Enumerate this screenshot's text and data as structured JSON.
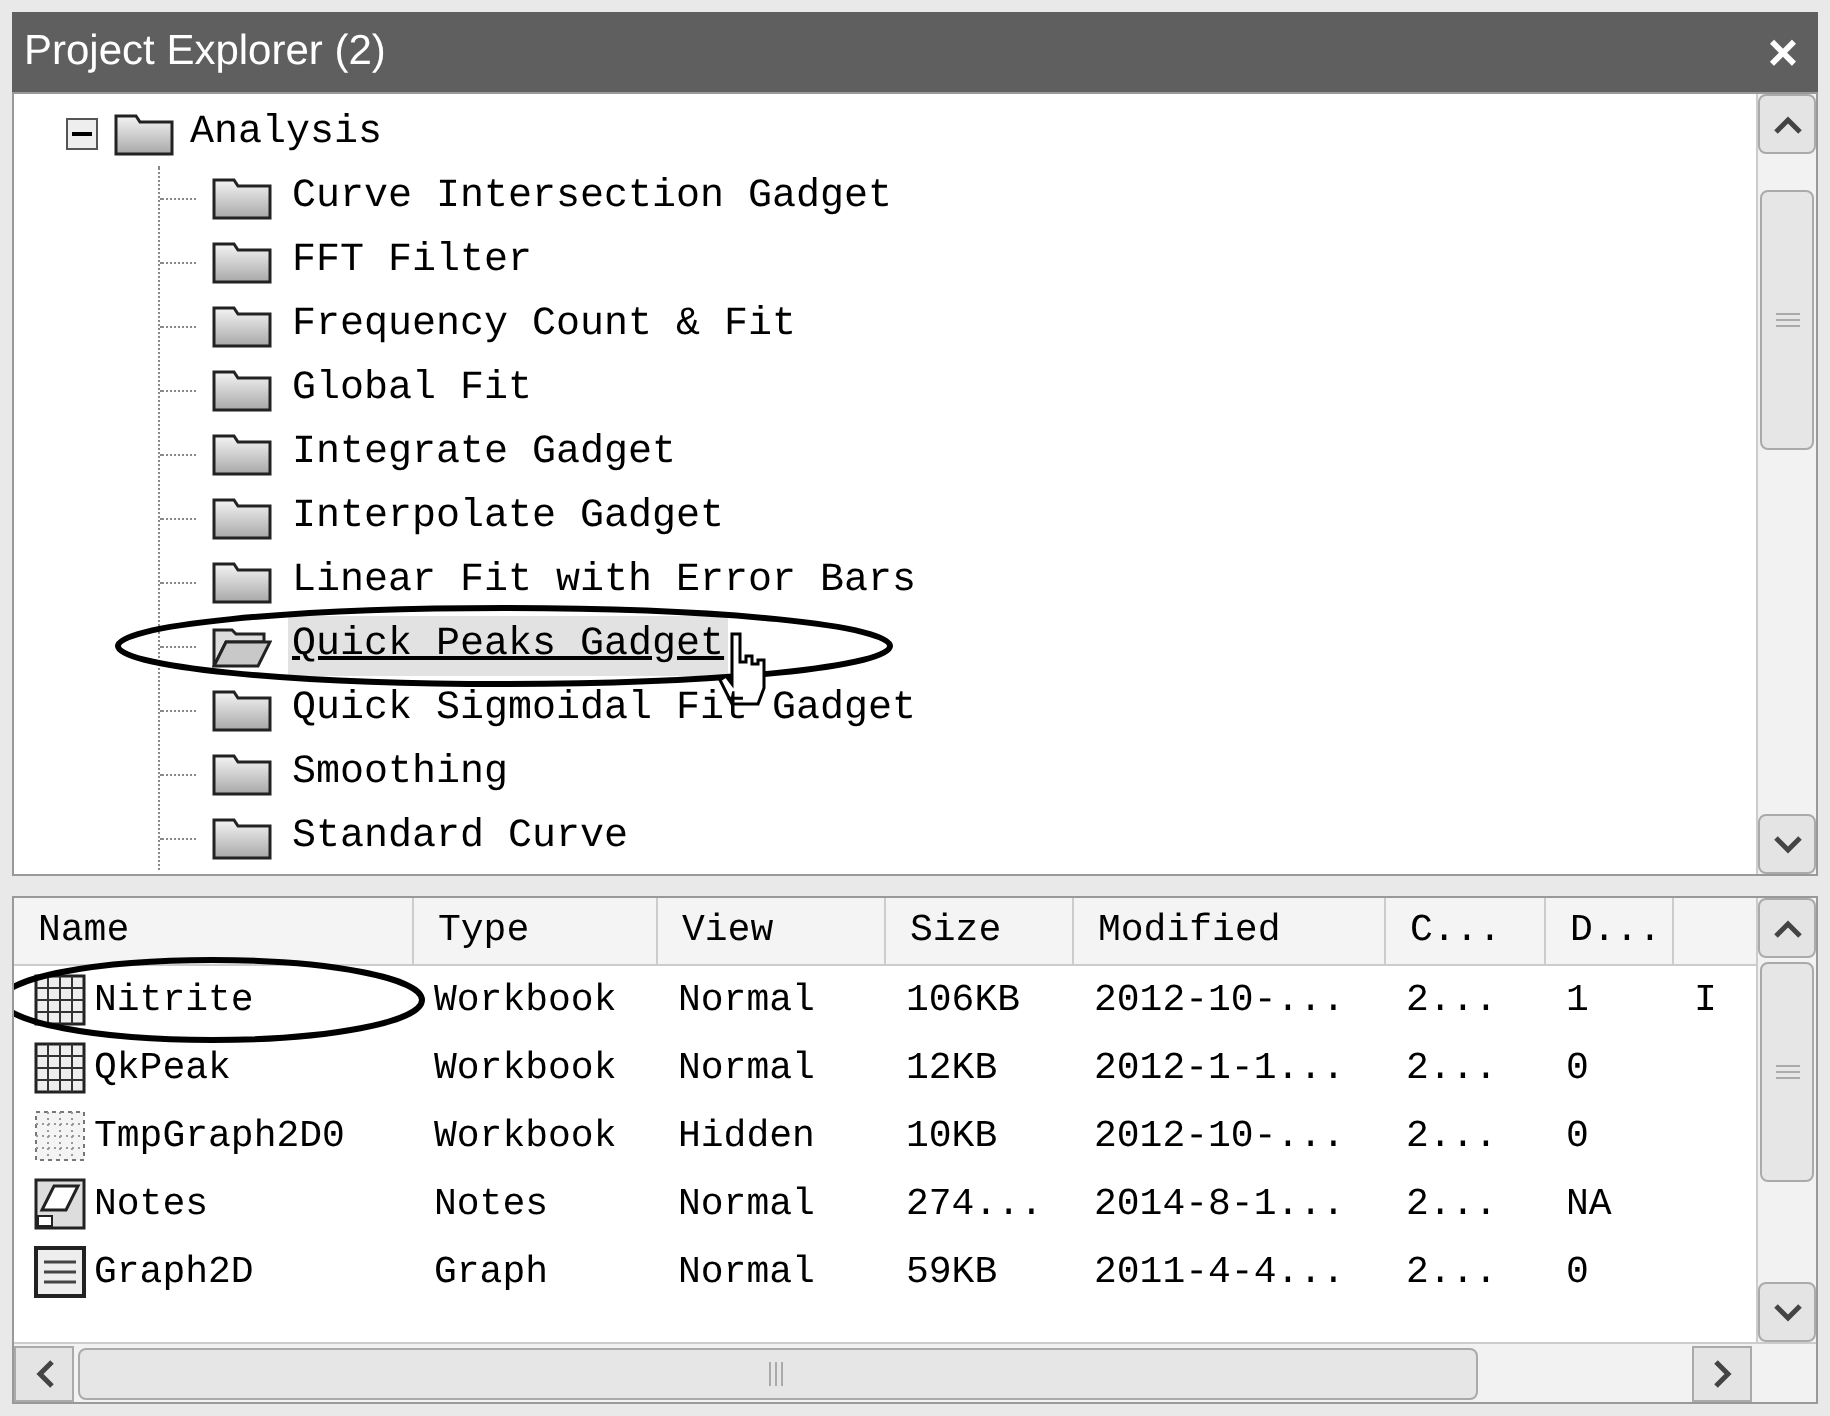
{
  "window": {
    "title": "Project Explorer (2)",
    "close": "×"
  },
  "tree": {
    "label": "Analysis",
    "expanded": true,
    "children": [
      {
        "label": "Curve Intersection Gadget",
        "selected": false
      },
      {
        "label": "FFT Filter",
        "selected": false
      },
      {
        "label": "Frequency Count & Fit",
        "selected": false
      },
      {
        "label": "Global Fit",
        "selected": false
      },
      {
        "label": "Integrate Gadget",
        "selected": false
      },
      {
        "label": "Interpolate Gadget",
        "selected": false
      },
      {
        "label": "Linear Fit with Error Bars",
        "selected": false
      },
      {
        "label": "Quick Peaks Gadget",
        "selected": true
      },
      {
        "label": "Quick Sigmoidal Fit Gadget",
        "selected": false
      },
      {
        "label": "Smoothing",
        "selected": false
      },
      {
        "label": "Standard Curve",
        "selected": false
      }
    ]
  },
  "table": {
    "columns": [
      "Name",
      "Type",
      "View",
      "Size",
      "Modified",
      "C...",
      "D..."
    ],
    "rows": [
      {
        "kind": "workbook",
        "cells": [
          "Nitrite",
          "Workbook",
          "Normal",
          "106KB",
          "2012-10-...",
          "2...",
          "1",
          "I"
        ],
        "circled": true
      },
      {
        "kind": "workbook",
        "cells": [
          "QkPeak",
          "Workbook",
          "Normal",
          "12KB",
          "2012-1-1...",
          "2...",
          "0"
        ],
        "circled": false
      },
      {
        "kind": "hidden",
        "cells": [
          "TmpGraph2D0",
          "Workbook",
          "Hidden",
          "10KB",
          "2012-10-...",
          "2...",
          "0"
        ],
        "circled": false
      },
      {
        "kind": "notes",
        "cells": [
          "Notes",
          "Notes",
          "Normal",
          "274...",
          "2014-8-1...",
          "2...",
          "NA"
        ],
        "circled": false
      },
      {
        "kind": "graph",
        "cells": [
          "Graph2D",
          "Graph",
          "Normal",
          "59KB",
          "2011-4-4...",
          "2...",
          "0"
        ],
        "circled": false
      }
    ]
  }
}
